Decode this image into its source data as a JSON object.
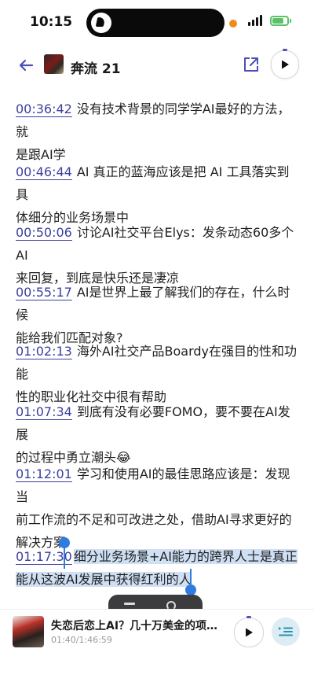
{
  "status": {
    "time": "10:15"
  },
  "header": {
    "title": "奔流 21"
  },
  "chapters": [
    {
      "ts": "00:36:42",
      "line1": "没有技术背景的同学学AI最好的方法，就",
      "line2": "是跟AI学"
    },
    {
      "ts": "00:46:44",
      "line1": "AI 真正的蓝海应该是把 AI 工具落实到具",
      "line2": "体细分的业务场景中"
    },
    {
      "ts": "00:50:06",
      "line1": "讨论AI社交平台Elys：发条动态60多个AI",
      "line2": "来回复，到底是快乐还是凄凉"
    },
    {
      "ts": "00:55:17",
      "line1": "AI是世界上最了解我们的存在，什么时候",
      "line2": "能给我们匹配对象?"
    },
    {
      "ts": "01:02:13",
      "line1": "海外AI社交产品Boardy在强目的性和功能",
      "line2": "性的职业化社交中很有帮助"
    },
    {
      "ts": "01:07:34",
      "line1": "到底有没有必要FOMO，要不要在AI发展",
      "line2": "的过程中勇立潮头😂"
    },
    {
      "ts": "01:12:01",
      "line1": "学习和使用AI的最佳思路应该是：发现当",
      "line2": "前工作流的不足和可改进之处，借助AI寻求更好的",
      "line3": "解决方案"
    },
    {
      "ts": "01:17:30",
      "line1": "细分业务场景+AI能力的跨界人士是真正",
      "line2": "能从这波AI发展中获得红利的人"
    }
  ],
  "player": {
    "title": "失恋后恋上AI？几十万美金的项目...",
    "time": "01:40/1:46:59"
  },
  "colors": {
    "accent": "#3b3f9c",
    "selection": "#cfe0f4",
    "caret": "#2f7ce0"
  },
  "icons": [
    "back-arrow-icon",
    "share-icon",
    "play-icon",
    "playlist-icon"
  ]
}
